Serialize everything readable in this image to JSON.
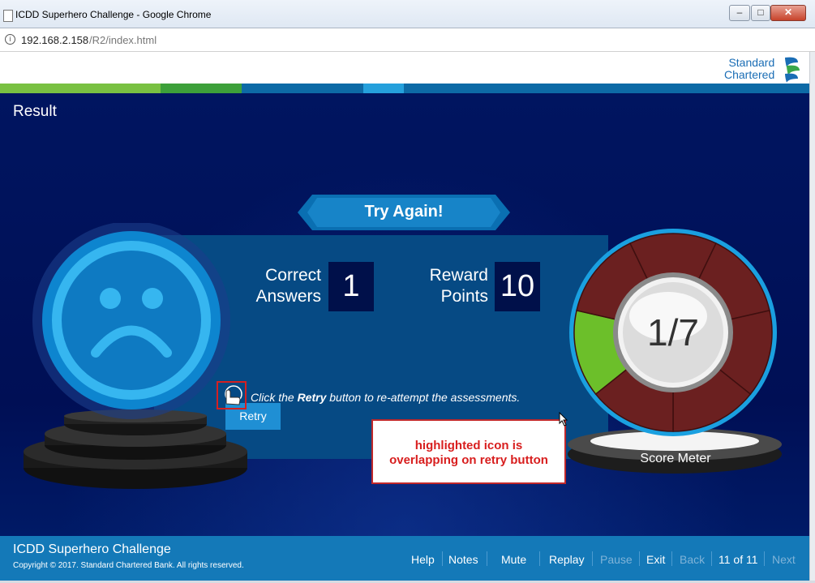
{
  "window": {
    "title": "ICDD Superhero Challenge - Google Chrome",
    "url_host": "192.168.2.158",
    "url_path": "/R2/index.html"
  },
  "brand": {
    "line1": "Standard",
    "line2": "Chartered"
  },
  "colors": {
    "stage": "#001560",
    "panel": "#064a84",
    "footer": "#1479b8",
    "meter_wrong": "#6b2020",
    "meter_correct": "#6cbf2a",
    "accent": "#1f8fd4"
  },
  "page": {
    "title": "Result"
  },
  "result": {
    "banner": "Try Again!",
    "correct_label_1": "Correct",
    "correct_label_2": "Answers",
    "correct_value": "1",
    "reward_label_1": "Reward",
    "reward_label_2": "Points",
    "reward_value": "10",
    "instruction_pre": "Click the ",
    "instruction_bold": "Retry",
    "instruction_post": " button to re-attempt the assessments.",
    "retry_label": "Retry"
  },
  "meter": {
    "ratio": "1/7",
    "label": "Score Meter",
    "correct": 1,
    "total": 7
  },
  "annotation": {
    "line1": "highlighted icon is",
    "line2": "overlapping on retry button"
  },
  "footer": {
    "title": "ICDD Superhero Challenge",
    "copyright": "Copyright © 2017. Standard Chartered Bank. All rights reserved.",
    "help": "Help",
    "notes": "Notes",
    "mute": "Mute",
    "replay": "Replay",
    "pause": "Pause",
    "exit": "Exit",
    "back": "Back",
    "page": "11 of 11",
    "next": "Next"
  }
}
